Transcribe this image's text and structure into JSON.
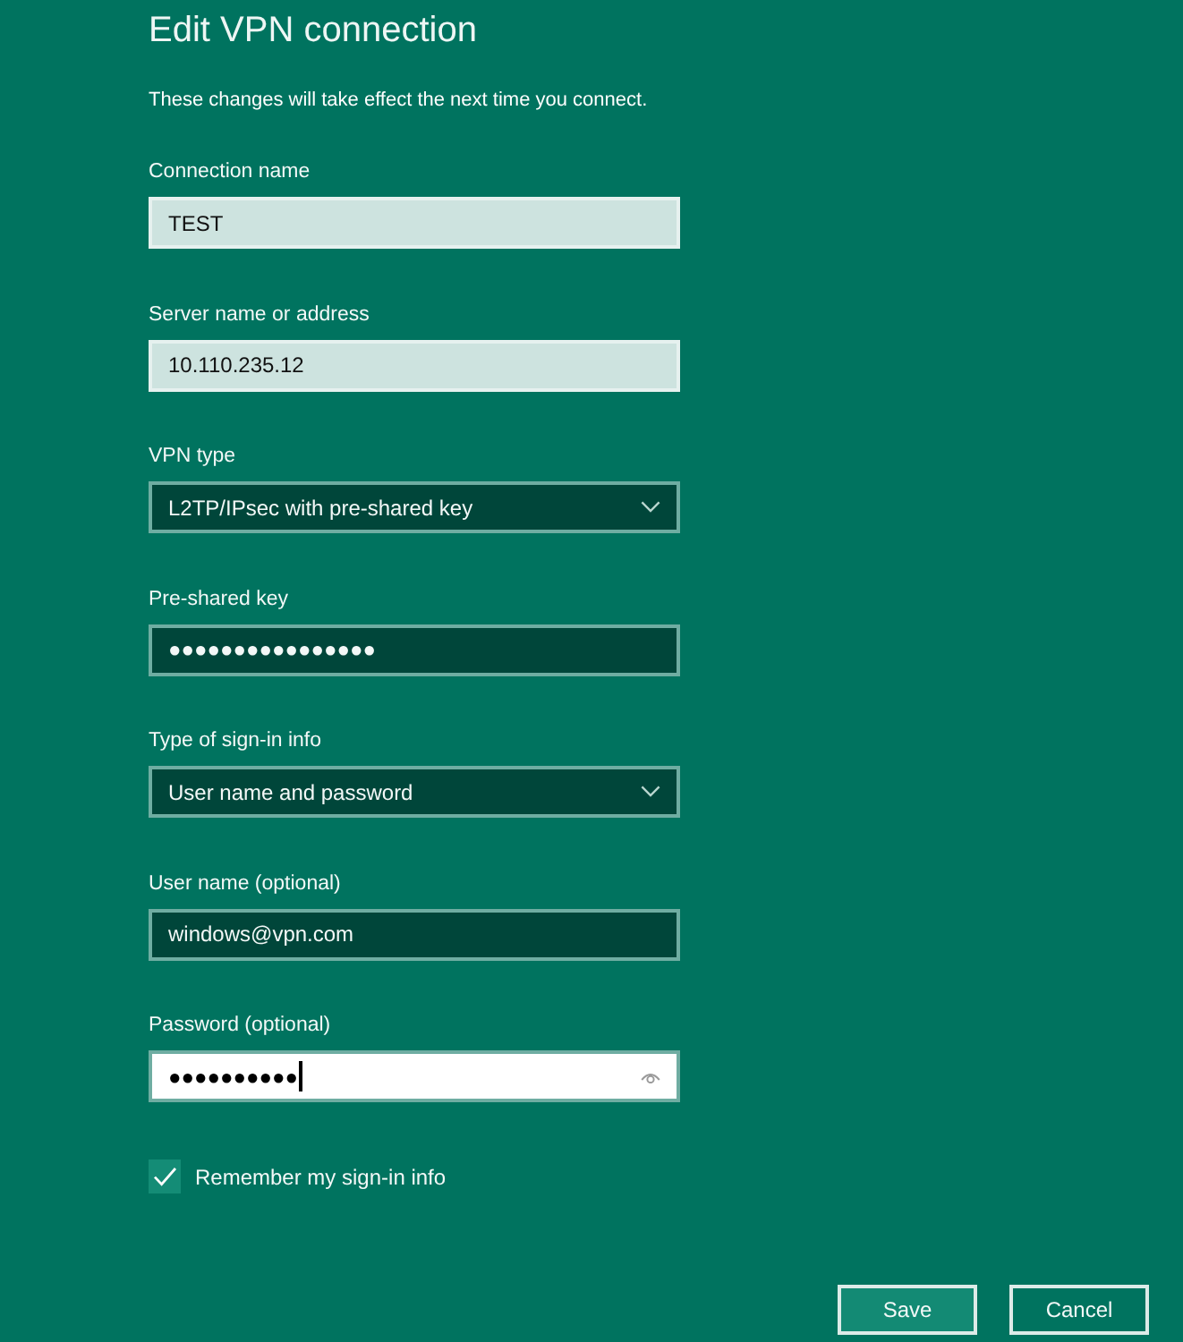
{
  "title": "Edit VPN connection",
  "subtitle": "These changes will take effect the next time you connect.",
  "fields": [
    {
      "label": "Connection name",
      "kind": "text",
      "value": "TEST",
      "highlighted": true,
      "focused": false
    },
    {
      "label": "Server name or address",
      "kind": "text",
      "value": "10.110.235.12",
      "highlighted": true,
      "focused": false
    },
    {
      "label": "VPN type",
      "kind": "dropdown",
      "value": "L2TP/IPsec with pre-shared key",
      "highlighted": false,
      "focused": false
    },
    {
      "label": "Pre-shared key",
      "kind": "password",
      "value": "●●●●●●●●●●●●●●●●",
      "highlighted": false,
      "focused": false
    },
    {
      "label": "Type of sign-in info",
      "kind": "dropdown",
      "value": "User name and password",
      "highlighted": false,
      "focused": false
    },
    {
      "label": "User name (optional)",
      "kind": "text",
      "value": "windows@vpn.com",
      "highlighted": false,
      "focused": false
    },
    {
      "label": "Password (optional)",
      "kind": "password",
      "value": "●●●●●●●●●●",
      "highlighted": false,
      "focused": true
    }
  ],
  "remember": {
    "label": "Remember my sign-in info",
    "checked": true
  },
  "buttons": [
    {
      "label": "Save",
      "kind": "primary"
    },
    {
      "label": "Cancel",
      "kind": "secondary"
    }
  ]
}
